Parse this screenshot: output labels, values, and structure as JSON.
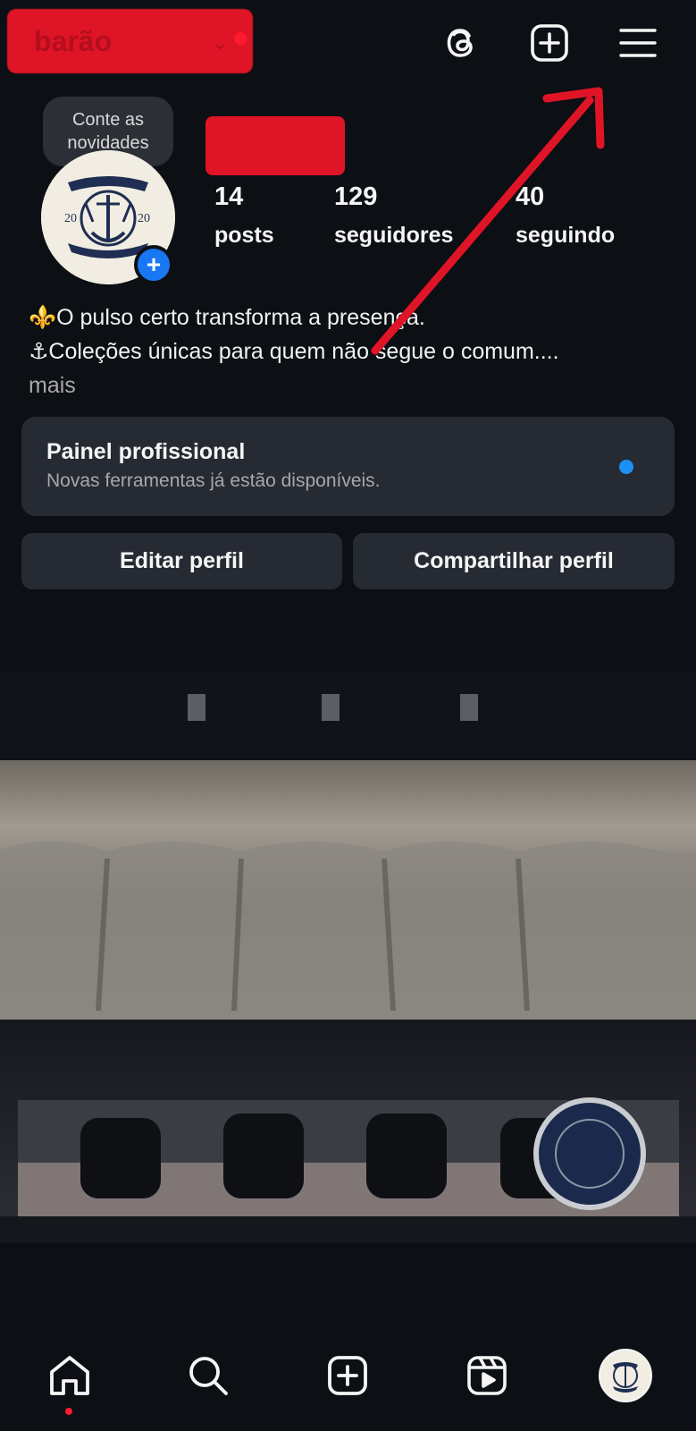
{
  "header": {
    "username": "barão",
    "chevron": "⌄",
    "icons": {
      "threads": "threads-icon",
      "new_post": "plus-square-icon",
      "menu": "hamburger-menu-icon"
    }
  },
  "profile": {
    "tooltip": "Conte as novidades",
    "avatar_add_glyph": "+",
    "stats": {
      "posts": {
        "count": "14",
        "label": "posts"
      },
      "followers": {
        "count": "129",
        "label": "seguidores"
      },
      "following": {
        "count": "40",
        "label": "seguindo"
      }
    },
    "bio": {
      "line1": "⚜️O pulso certo transforma a presença.",
      "line2": "⚓Coleções únicas para quem não segue o comum....",
      "more": "mais"
    }
  },
  "pro_dashboard": {
    "title": "Painel profissional",
    "subtitle": "Novas ferramentas já estão disponíveis."
  },
  "actions": {
    "edit": "Editar perfil",
    "share": "Compartilhar perfil"
  },
  "bottom_nav": [
    "home-icon",
    "search-icon",
    "create-icon",
    "reels-icon",
    "profile-avatar"
  ],
  "colors": {
    "background": "#0c0f14",
    "surface": "#262a33",
    "accent": "#1d90f5",
    "annotation": "#e01427"
  }
}
